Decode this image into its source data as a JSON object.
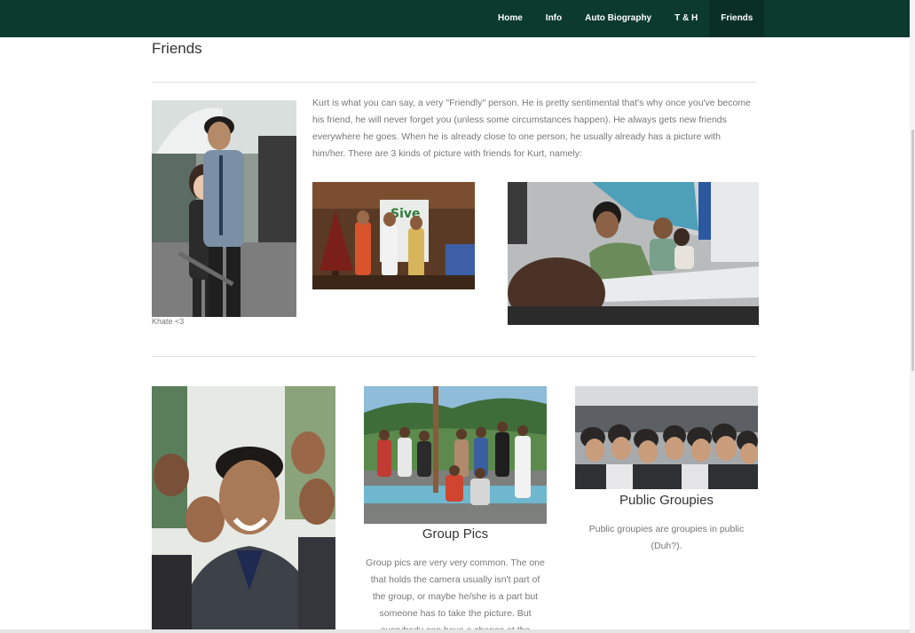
{
  "nav": {
    "items": [
      {
        "label": "Home",
        "active": false
      },
      {
        "label": "Info",
        "active": false
      },
      {
        "label": "Auto Biography",
        "active": false
      },
      {
        "label": "T & H",
        "active": false
      },
      {
        "label": "Friends",
        "active": true
      }
    ]
  },
  "page": {
    "title": "Friends",
    "intro": "Kurt is what you can say, a very \"Friendly\" person.  He is pretty sentimental that's why once you've  become his friend, he will never forget you (unless some circumstances happen). He always gets new friends everywhere he goes. When he is already close to one person, he usually already has a picture with him/her. There are 3 kinds of picture with friends for Kurt, namely:",
    "main_photo_caption": "Khate <3"
  },
  "columns": [
    {
      "title": "",
      "text": ""
    },
    {
      "title": "Group Pics",
      "text": "Group pics are very very common. The one that holds the camera usually isn't part of the group, or maybe he/she is a part but someone has to take the picture. But everybody can have a chance at the picture."
    },
    {
      "title": "Public Groupies",
      "text": "Public groupies are groupies in public (Duh?)."
    }
  ],
  "colors": {
    "nav_bg": "#0c3a2d",
    "nav_active_bg": "#0a2f24",
    "text_body": "#777777",
    "text_heading": "#333333"
  }
}
